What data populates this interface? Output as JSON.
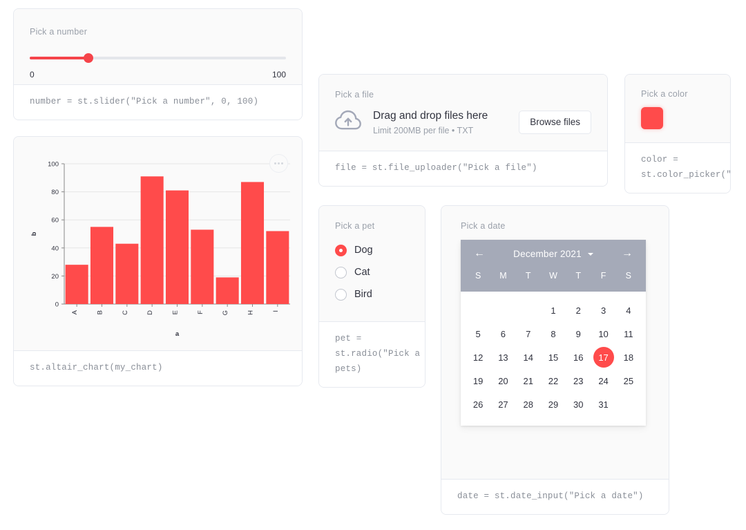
{
  "accent": "#ff4b4b",
  "slider_card": {
    "label": "Pick a number",
    "value_percent": 23,
    "min_label": "0",
    "max_label": "100",
    "code": "number = st.slider(\"Pick a number\", 0, 100)"
  },
  "chart_card": {
    "menu_icon": "overflow-dots-icon",
    "code": "st.altair_chart(my_chart)"
  },
  "chart_data": {
    "type": "bar",
    "title": "",
    "xlabel": "a",
    "ylabel": "b",
    "categories": [
      "A",
      "B",
      "C",
      "D",
      "E",
      "F",
      "G",
      "H",
      "I"
    ],
    "values": [
      28,
      55,
      43,
      91,
      81,
      53,
      19,
      87,
      52
    ],
    "ylim": [
      0,
      100
    ],
    "yticks": [
      0,
      20,
      40,
      60,
      80,
      100
    ],
    "grid": true,
    "legend": "none",
    "bar_color": "#ff4b4b",
    "xtick_rotation": -90
  },
  "file_card": {
    "label": "Pick a file",
    "icon": "cloud-upload-icon",
    "drop_title": "Drag and drop files here",
    "drop_sub": "Limit 200MB per file • TXT",
    "browse_label": "Browse files",
    "code": "file = st.file_uploader(\"Pick a file\")"
  },
  "color_card": {
    "label": "Pick a color",
    "swatch_color": "#ff4b4b",
    "code": "color =\nst.color_picker(\"Pi"
  },
  "radio_card": {
    "label": "Pick a pet",
    "options": [
      {
        "label": "Dog",
        "selected": true
      },
      {
        "label": "Cat",
        "selected": false
      },
      {
        "label": "Bird",
        "selected": false
      }
    ],
    "code": "pet =\nst.radio(\"Pick a pe\npets)"
  },
  "date_card": {
    "label": "Pick a date",
    "prev_icon": "arrow-left-icon",
    "next_icon": "arrow-right-icon",
    "month_title": "December 2021",
    "dropdown_icon": "caret-down-icon",
    "weekdays": [
      "S",
      "M",
      "T",
      "W",
      "T",
      "F",
      "S"
    ],
    "leading_blanks": 3,
    "days": [
      1,
      2,
      3,
      4,
      5,
      6,
      7,
      8,
      9,
      10,
      11,
      12,
      13,
      14,
      15,
      16,
      17,
      18,
      19,
      20,
      21,
      22,
      23,
      24,
      25,
      26,
      27,
      28,
      29,
      30,
      31
    ],
    "selected_day": 17,
    "code": "date = st.date_input(\"Pick a date\")"
  }
}
